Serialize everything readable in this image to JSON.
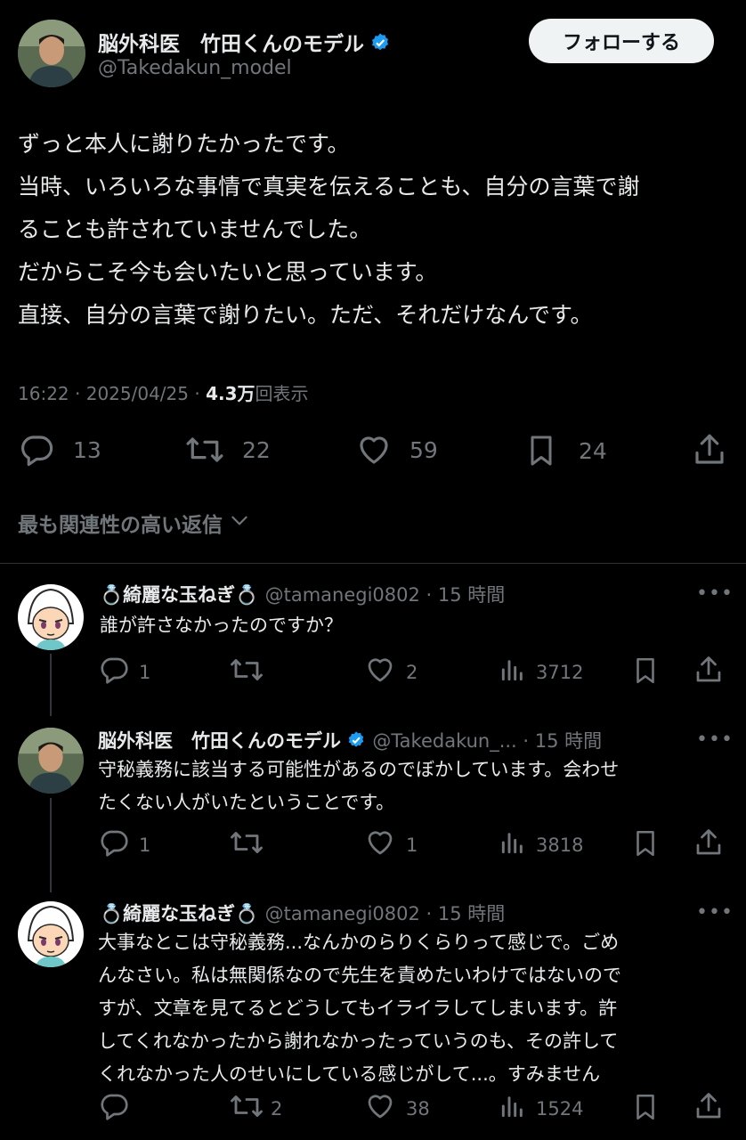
{
  "post": {
    "author_name": "脳外科医　竹田くんのモデル",
    "author_handle": "@Takedakun_model",
    "follow_label": "フォローする",
    "text_lines": [
      "ずっと本人に謝りたかったです。",
      "当時、いろいろな事情で真実を伝えることも、自分の言葉で謝",
      "ることも許されていませんでした。",
      "だからこそ今も会いたいと思っています。",
      "直接、自分の言葉で謝りたい。ただ、それだけなんです。"
    ],
    "time": "16:22",
    "date": "2025/04/25",
    "views_count": "4.3万",
    "views_label": "回表示",
    "replies": "13",
    "reposts": "22",
    "likes": "59",
    "bookmarks": "24",
    "sort_label": "最も関連性の高い返信"
  },
  "replies": [
    {
      "name": "💍綺麗な玉ねぎ💍",
      "handle": "@tamanegi0802",
      "time": "15 時間",
      "lines": [
        "誰が許さなかったのですか？"
      ],
      "reply_count": "1",
      "repost_count": "",
      "like_count": "2",
      "view_count": "3712"
    },
    {
      "name": "脳外科医　竹田くんのモデル",
      "handle": "@Takedakun_...",
      "time": "15 時間",
      "lines": [
        "守秘義務に該当する可能性があるのでぼかしています。会わせ",
        "たくない人がいたということです。"
      ],
      "reply_count": "1",
      "repost_count": "",
      "like_count": "1",
      "view_count": "3818"
    },
    {
      "name": "💍綺麗な玉ねぎ💍",
      "handle": "@tamanegi0802",
      "time": "15 時間",
      "lines": [
        "大事なとこは守秘義務...なんかのらりくらりって感じで。ごめ",
        "んなさい。私は無関係なので先生を責めたいわけではないので",
        "すが、文章を見てるとどうしてもイライラしてしまいます。許",
        "してくれなかったから謝れなかったっていうのも、その許して",
        "くれなかった人のせいにしている感じがして...。すみません"
      ],
      "reply_count": "",
      "repost_count": "2",
      "like_count": "38",
      "view_count": "1524"
    }
  ],
  "colors": {
    "background": "#000000",
    "text": "#e7e9ea",
    "muted": "#71767b",
    "verified": "#1d9bf0",
    "divider": "#2f3336"
  },
  "icons": [
    "reply-icon",
    "repost-icon",
    "like-icon",
    "bookmark-icon",
    "share-icon",
    "views-icon",
    "more-icon",
    "verified-icon",
    "chevron-down-icon"
  ]
}
